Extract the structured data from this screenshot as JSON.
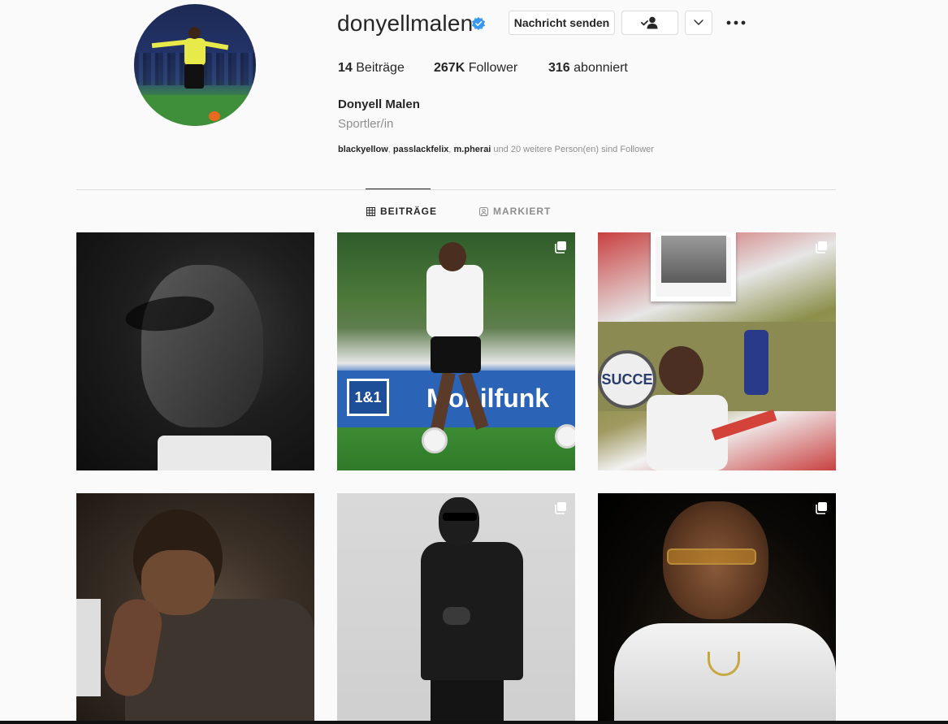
{
  "profile": {
    "username": "donyellmalen",
    "verified": true,
    "message_button": "Nachricht senden",
    "stats": {
      "posts_count": "14",
      "posts_label": "Beiträge",
      "followers_count": "267K",
      "followers_label": "Follower",
      "following_count": "316",
      "following_label": "abonniert"
    },
    "full_name": "Donyell Malen",
    "category": "Sportler/in",
    "followed_by": {
      "user1": "blackyellow",
      "sep1": ", ",
      "user2": "passlackfelix",
      "sep2": ", ",
      "user3": "m.pherai",
      "rest": " und 20 weitere Person(en) sind Follower"
    }
  },
  "tabs": {
    "posts": "BEITRÄGE",
    "tagged": "MARKIERT"
  },
  "grid": {
    "tile2_banner": "Mobilfunk",
    "tile2_logo": "1&1",
    "tile3_badge": "SUCCE"
  },
  "colors": {
    "verified_blue": "#3897f0",
    "text_primary": "#262626",
    "text_secondary": "#8e8e8e",
    "border": "#dbdbdb",
    "background": "#fafafa"
  },
  "icons": {
    "verified": "verified-badge-icon",
    "follow": "person-check-icon",
    "dropdown": "chevron-down-icon",
    "more": "more-horizontal-icon",
    "posts_tab": "grid-icon",
    "tagged_tab": "tagged-person-icon",
    "multi_post": "carousel-icon"
  }
}
